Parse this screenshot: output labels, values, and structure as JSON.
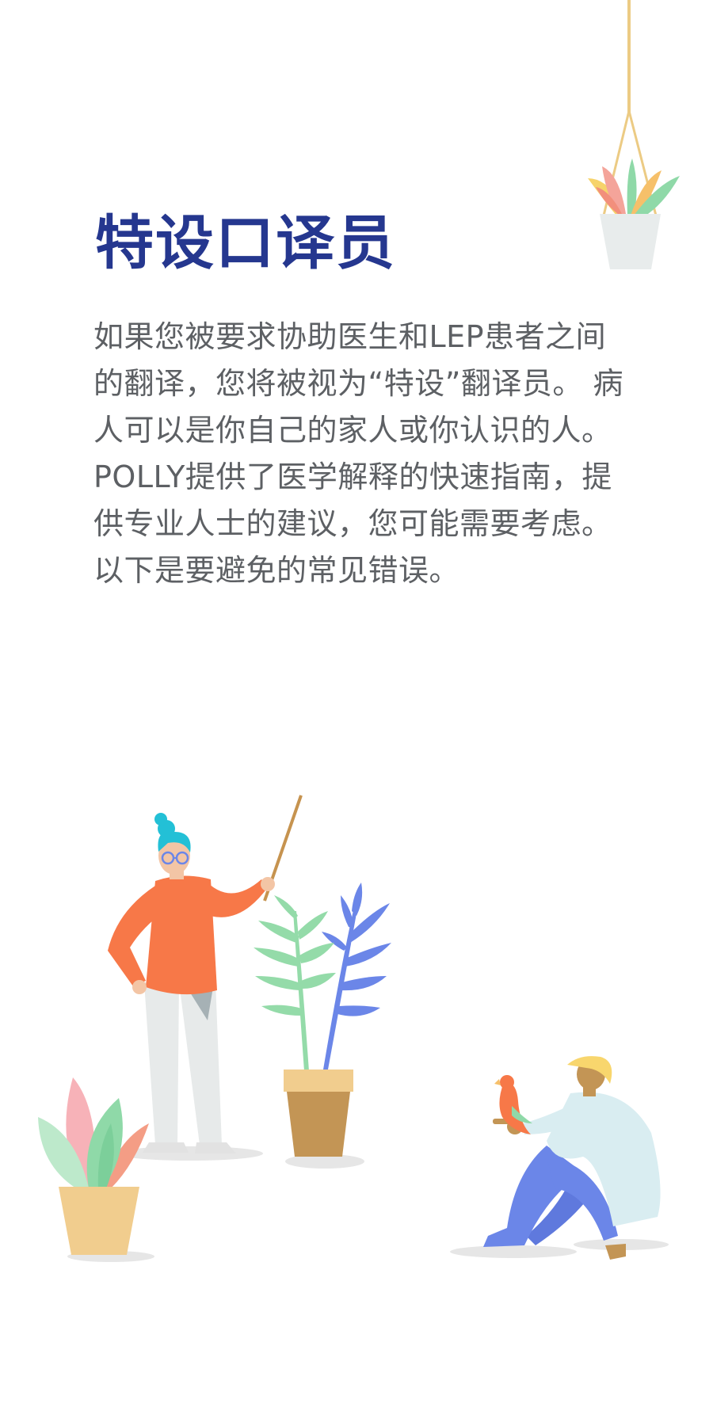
{
  "intro": {
    "title": "特设口译员",
    "body": "如果您被要求协助医生和LEP患者之间的翻译，您将被视为“特设”翻译员。 病人可以是你自己的家人或你认识的人。 POLLY提供了医学解释的快速指南，提供专业人士的建议，您可能需要考虑。 以下是要避免的常见错误。"
  },
  "colors": {
    "title": "#25378f",
    "body_text": "#5d6064",
    "background": "#ffffff"
  },
  "illustrations": {
    "hanging_planter": "hanging-plant-pot-illustration",
    "teacher": "woman-with-pointer-illustration",
    "center_plant": "potted-fern-illustration",
    "left_plant": "potted-leaf-plant-illustration",
    "sitting_man": "man-with-parrot-illustration"
  }
}
